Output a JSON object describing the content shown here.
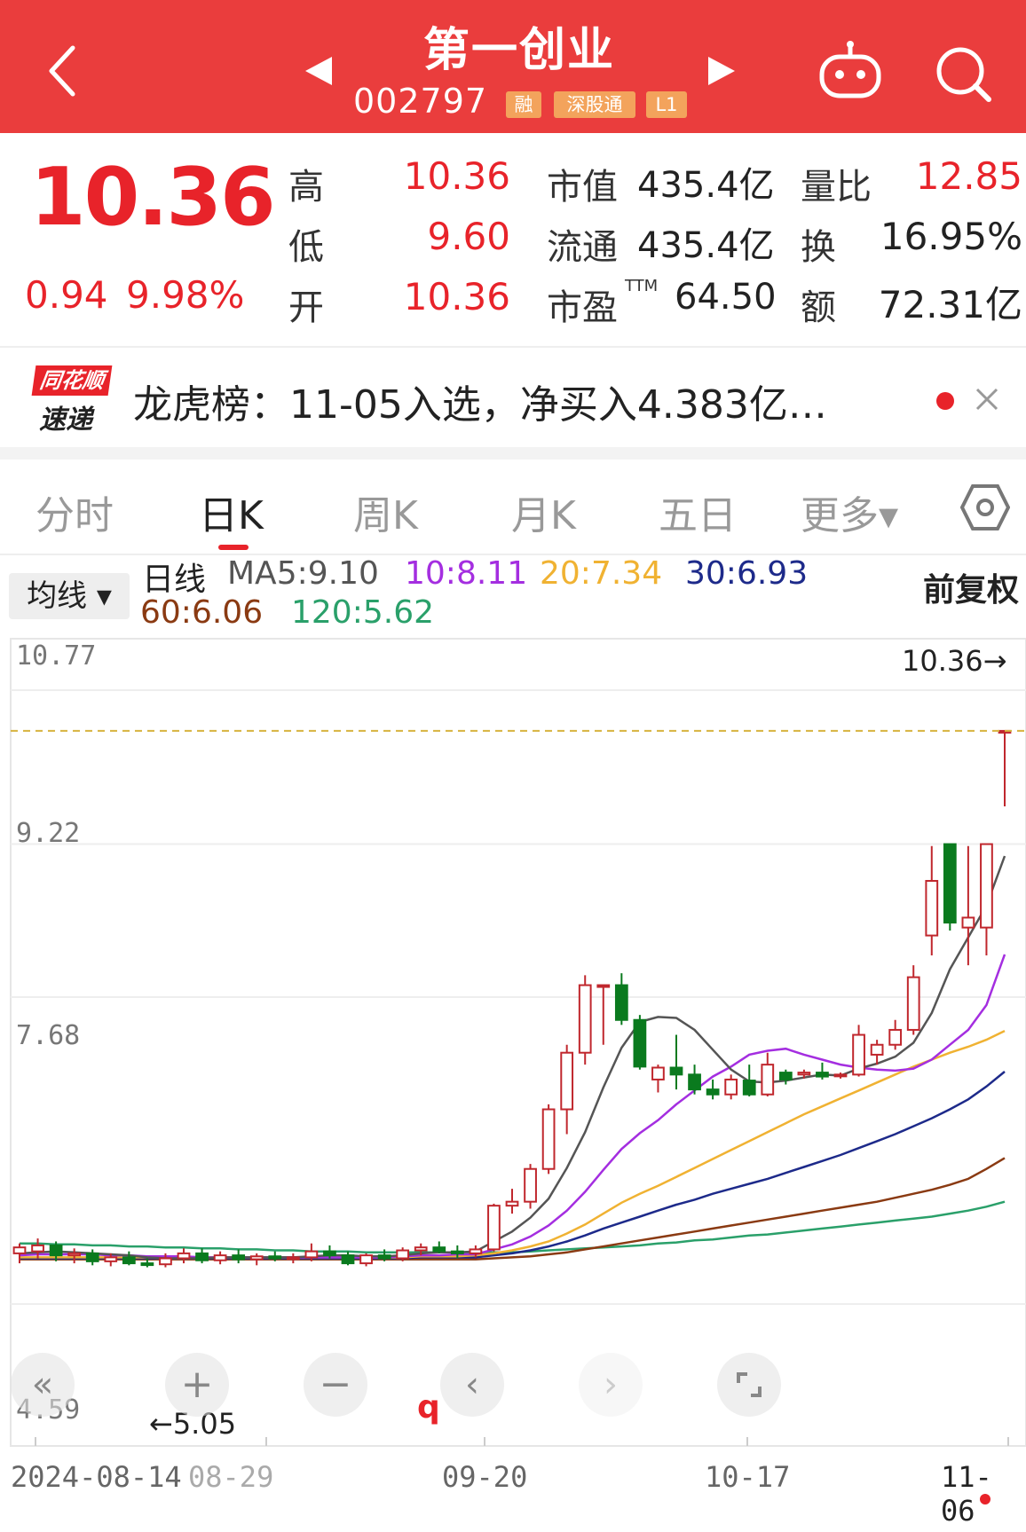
{
  "header": {
    "title": "第一创业",
    "code": "002797",
    "tags": [
      "融",
      "深股通",
      "L1"
    ]
  },
  "quote": {
    "price": "10.36",
    "change": "0.94",
    "change_pct": "9.98%",
    "stats": {
      "high_label": "高",
      "high": "10.36",
      "low_label": "低",
      "low": "9.60",
      "open_label": "开",
      "open": "10.36",
      "mktcap_label": "市值",
      "mktcap": "435.4亿",
      "float_label": "流通",
      "float": "435.4亿",
      "pe_label": "市盈",
      "pe_sup": "TTM",
      "pe": "64.50",
      "volratio_label": "量比",
      "volratio": "12.85",
      "turnover_label": "换",
      "turnover": "16.95%",
      "amount_label": "额",
      "amount": "72.31亿"
    }
  },
  "news": {
    "logo_top": "同花顺",
    "logo_bottom": "速递",
    "text": "龙虎榜：11-05入选，净买入4.383亿…"
  },
  "tabs": [
    "分时",
    "日K",
    "周K",
    "月K",
    "五日",
    "更多▾"
  ],
  "active_tab": "日K",
  "indicator": {
    "avg_button": "均线 ▾",
    "line_label": "日线",
    "ma5": "MA5:9.10",
    "ma10": "10:8.11",
    "ma20": "20:7.34",
    "ma30": "30:6.93",
    "ma60": "60:6.06",
    "ma120": "120:5.62",
    "adjust": "前复权"
  },
  "colors": {
    "up": "#c0272d",
    "down": "#0a7a1e",
    "ma5": "#555555",
    "ma10": "#a42ee0",
    "ma20": "#f0b232",
    "ma30": "#1d2a8a",
    "ma60": "#8a3a12",
    "ma120": "#2aa06a"
  },
  "chart_data": {
    "type": "candlestick",
    "y_ticks": [
      "10.77",
      "9.22",
      "7.68",
      "4.59"
    ],
    "ylim": [
      4.59,
      10.77
    ],
    "x_ticks": [
      "2024-08-14",
      "08-29",
      "09-20",
      "10-17",
      "11-06"
    ],
    "last_price_marker": "10.36→",
    "min_price_marker": "←5.05",
    "event_marker": "q",
    "candles": [
      {
        "o": 5.1,
        "h": 5.2,
        "l": 5.0,
        "c": 5.16
      },
      {
        "o": 5.12,
        "h": 5.25,
        "l": 5.05,
        "c": 5.18
      },
      {
        "o": 5.18,
        "h": 5.22,
        "l": 5.02,
        "c": 5.08
      },
      {
        "o": 5.08,
        "h": 5.15,
        "l": 5.0,
        "c": 5.1
      },
      {
        "o": 5.1,
        "h": 5.14,
        "l": 4.98,
        "c": 5.02
      },
      {
        "o": 5.02,
        "h": 5.1,
        "l": 4.97,
        "c": 5.06
      },
      {
        "o": 5.06,
        "h": 5.12,
        "l": 4.98,
        "c": 5.0
      },
      {
        "o": 5.0,
        "h": 5.05,
        "l": 4.96,
        "c": 4.99
      },
      {
        "o": 4.99,
        "h": 5.1,
        "l": 4.96,
        "c": 5.05
      },
      {
        "o": 5.05,
        "h": 5.15,
        "l": 5.0,
        "c": 5.1
      },
      {
        "o": 5.1,
        "h": 5.15,
        "l": 5.0,
        "c": 5.03
      },
      {
        "o": 5.03,
        "h": 5.12,
        "l": 4.99,
        "c": 5.08
      },
      {
        "o": 5.08,
        "h": 5.14,
        "l": 5.0,
        "c": 5.04
      },
      {
        "o": 5.04,
        "h": 5.1,
        "l": 4.98,
        "c": 5.07
      },
      {
        "o": 5.07,
        "h": 5.12,
        "l": 5.02,
        "c": 5.05
      },
      {
        "o": 5.05,
        "h": 5.1,
        "l": 5.0,
        "c": 5.06
      },
      {
        "o": 5.06,
        "h": 5.2,
        "l": 5.02,
        "c": 5.12
      },
      {
        "o": 5.12,
        "h": 5.18,
        "l": 5.05,
        "c": 5.08
      },
      {
        "o": 5.08,
        "h": 5.12,
        "l": 4.98,
        "c": 5.0
      },
      {
        "o": 5.0,
        "h": 5.1,
        "l": 4.97,
        "c": 5.08
      },
      {
        "o": 5.08,
        "h": 5.14,
        "l": 5.02,
        "c": 5.05
      },
      {
        "o": 5.05,
        "h": 5.16,
        "l": 5.02,
        "c": 5.13
      },
      {
        "o": 5.13,
        "h": 5.2,
        "l": 5.08,
        "c": 5.16
      },
      {
        "o": 5.16,
        "h": 5.22,
        "l": 5.1,
        "c": 5.12
      },
      {
        "o": 5.12,
        "h": 5.18,
        "l": 5.05,
        "c": 5.1
      },
      {
        "o": 5.1,
        "h": 5.18,
        "l": 5.06,
        "c": 5.14
      },
      {
        "o": 5.14,
        "h": 5.6,
        "l": 5.12,
        "c": 5.58
      },
      {
        "o": 5.58,
        "h": 5.75,
        "l": 5.5,
        "c": 5.62
      },
      {
        "o": 5.62,
        "h": 6.0,
        "l": 5.55,
        "c": 5.95
      },
      {
        "o": 5.95,
        "h": 6.6,
        "l": 5.9,
        "c": 6.55
      },
      {
        "o": 6.55,
        "h": 7.2,
        "l": 6.3,
        "c": 7.12
      },
      {
        "o": 7.12,
        "h": 7.9,
        "l": 7.0,
        "c": 7.8
      },
      {
        "o": 7.8,
        "h": 7.8,
        "l": 7.2,
        "c": 7.8
      },
      {
        "o": 7.8,
        "h": 7.92,
        "l": 7.4,
        "c": 7.45
      },
      {
        "o": 7.45,
        "h": 7.5,
        "l": 6.95,
        "c": 6.98
      },
      {
        "o": 6.85,
        "h": 7.0,
        "l": 6.72,
        "c": 6.97
      },
      {
        "o": 6.97,
        "h": 7.3,
        "l": 6.75,
        "c": 6.9
      },
      {
        "o": 6.9,
        "h": 7.0,
        "l": 6.7,
        "c": 6.75
      },
      {
        "o": 6.75,
        "h": 6.85,
        "l": 6.65,
        "c": 6.7
      },
      {
        "o": 6.7,
        "h": 6.9,
        "l": 6.65,
        "c": 6.85
      },
      {
        "o": 6.84,
        "h": 7.0,
        "l": 6.68,
        "c": 6.7
      },
      {
        "o": 6.7,
        "h": 7.12,
        "l": 6.68,
        "c": 7.0
      },
      {
        "o": 6.92,
        "h": 6.95,
        "l": 6.8,
        "c": 6.85
      },
      {
        "o": 6.9,
        "h": 6.95,
        "l": 6.86,
        "c": 6.92
      },
      {
        "o": 6.92,
        "h": 7.02,
        "l": 6.85,
        "c": 6.88
      },
      {
        "o": 6.89,
        "h": 6.92,
        "l": 6.86,
        "c": 6.9
      },
      {
        "o": 6.9,
        "h": 7.4,
        "l": 6.88,
        "c": 7.3
      },
      {
        "o": 7.1,
        "h": 7.25,
        "l": 7.0,
        "c": 7.2
      },
      {
        "o": 7.2,
        "h": 7.45,
        "l": 7.15,
        "c": 7.35
      },
      {
        "o": 7.35,
        "h": 8.0,
        "l": 7.3,
        "c": 7.88
      },
      {
        "o": 8.3,
        "h": 9.2,
        "l": 8.1,
        "c": 8.85
      },
      {
        "o": 9.22,
        "h": 9.22,
        "l": 8.35,
        "c": 8.43
      },
      {
        "o": 8.38,
        "h": 9.2,
        "l": 8.0,
        "c": 8.48
      },
      {
        "o": 8.38,
        "h": 9.22,
        "l": 8.1,
        "c": 9.22
      },
      {
        "o": 10.36,
        "h": 10.36,
        "l": 9.6,
        "c": 10.36
      }
    ],
    "ma5": [
      5.1,
      5.11,
      5.12,
      5.11,
      5.1,
      5.09,
      5.08,
      5.06,
      5.05,
      5.05,
      5.05,
      5.06,
      5.06,
      5.06,
      5.06,
      5.06,
      5.07,
      5.08,
      5.08,
      5.07,
      5.07,
      5.08,
      5.1,
      5.11,
      5.11,
      5.12,
      5.22,
      5.32,
      5.46,
      5.65,
      5.96,
      6.32,
      6.77,
      7.17,
      7.43,
      7.48,
      7.47,
      7.35,
      7.15,
      6.95,
      6.83,
      6.82,
      6.84,
      6.87,
      6.9,
      6.89,
      6.96,
      7.01,
      7.08,
      7.22,
      7.52,
      7.96,
      8.28,
      8.6,
      9.1
    ],
    "ma10": [
      5.08,
      5.09,
      5.09,
      5.09,
      5.09,
      5.08,
      5.08,
      5.07,
      5.07,
      5.07,
      5.06,
      5.06,
      5.06,
      5.06,
      5.06,
      5.06,
      5.06,
      5.06,
      5.06,
      5.06,
      5.06,
      5.07,
      5.08,
      5.08,
      5.09,
      5.09,
      5.14,
      5.19,
      5.27,
      5.38,
      5.53,
      5.72,
      5.94,
      6.15,
      6.31,
      6.44,
      6.6,
      6.74,
      6.88,
      6.98,
      7.1,
      7.14,
      7.16,
      7.1,
      7.05,
      7.0,
      6.97,
      6.95,
      6.94,
      6.96,
      7.05,
      7.2,
      7.35,
      7.6,
      8.11
    ],
    "ma20": [
      5.06,
      5.06,
      5.06,
      5.06,
      5.06,
      5.06,
      5.06,
      5.06,
      5.06,
      5.06,
      5.06,
      5.06,
      5.06,
      5.06,
      5.06,
      5.06,
      5.06,
      5.06,
      5.06,
      5.06,
      5.06,
      5.06,
      5.07,
      5.07,
      5.07,
      5.08,
      5.1,
      5.13,
      5.17,
      5.22,
      5.3,
      5.39,
      5.5,
      5.61,
      5.7,
      5.78,
      5.87,
      5.96,
      6.05,
      6.14,
      6.23,
      6.32,
      6.41,
      6.5,
      6.58,
      6.66,
      6.74,
      6.82,
      6.9,
      6.98,
      7.05,
      7.12,
      7.18,
      7.25,
      7.34
    ],
    "ma30": [
      5.05,
      5.05,
      5.05,
      5.05,
      5.05,
      5.05,
      5.05,
      5.05,
      5.05,
      5.05,
      5.05,
      5.05,
      5.05,
      5.05,
      5.05,
      5.05,
      5.05,
      5.05,
      5.05,
      5.05,
      5.05,
      5.05,
      5.06,
      5.06,
      5.06,
      5.06,
      5.08,
      5.1,
      5.13,
      5.17,
      5.22,
      5.28,
      5.35,
      5.41,
      5.47,
      5.53,
      5.59,
      5.64,
      5.7,
      5.75,
      5.8,
      5.85,
      5.91,
      5.97,
      6.03,
      6.09,
      6.16,
      6.23,
      6.3,
      6.38,
      6.46,
      6.55,
      6.65,
      6.78,
      6.93
    ],
    "ma60": [
      5.04,
      5.04,
      5.04,
      5.04,
      5.04,
      5.04,
      5.04,
      5.04,
      5.04,
      5.04,
      5.04,
      5.04,
      5.04,
      5.04,
      5.04,
      5.04,
      5.04,
      5.04,
      5.04,
      5.04,
      5.04,
      5.04,
      5.04,
      5.04,
      5.04,
      5.04,
      5.05,
      5.06,
      5.07,
      5.09,
      5.11,
      5.14,
      5.17,
      5.2,
      5.23,
      5.26,
      5.29,
      5.32,
      5.35,
      5.38,
      5.41,
      5.44,
      5.47,
      5.5,
      5.53,
      5.56,
      5.59,
      5.62,
      5.66,
      5.7,
      5.74,
      5.79,
      5.85,
      5.95,
      6.06
    ],
    "ma120": [
      5.2,
      5.2,
      5.19,
      5.19,
      5.18,
      5.18,
      5.17,
      5.17,
      5.16,
      5.16,
      5.15,
      5.15,
      5.14,
      5.14,
      5.13,
      5.13,
      5.12,
      5.12,
      5.12,
      5.11,
      5.11,
      5.11,
      5.11,
      5.11,
      5.11,
      5.11,
      5.11,
      5.11,
      5.12,
      5.13,
      5.14,
      5.15,
      5.16,
      5.17,
      5.18,
      5.2,
      5.21,
      5.23,
      5.24,
      5.26,
      5.28,
      5.29,
      5.31,
      5.33,
      5.35,
      5.37,
      5.39,
      5.41,
      5.43,
      5.45,
      5.47,
      5.5,
      5.53,
      5.57,
      5.62
    ]
  }
}
